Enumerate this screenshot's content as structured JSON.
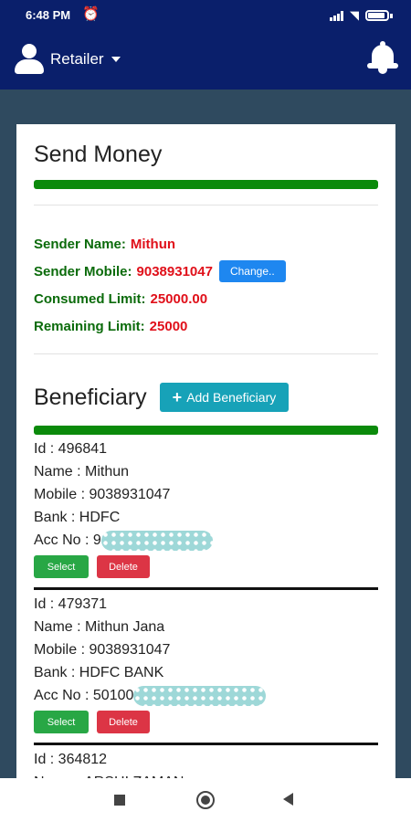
{
  "status_bar": {
    "time": "6:48 PM",
    "alarm_icon": "alarm-clock-icon"
  },
  "app_bar": {
    "role_label": "Retailer",
    "user_icon": "user-icon",
    "notification_icon": "bell-icon"
  },
  "send_money": {
    "title": "Send Money",
    "sender_name_label": "Sender Name:",
    "sender_name": "Mithun",
    "sender_mobile_label": "Sender Mobile:",
    "sender_mobile": "9038931047",
    "change_button": "Change..",
    "consumed_limit_label": "Consumed Limit:",
    "consumed_limit": "25000.00",
    "remaining_limit_label": "Remaining Limit:",
    "remaining_limit": "25000"
  },
  "beneficiary": {
    "title": "Beneficiary",
    "add_button": "Add Beneficiary",
    "select_label": "Select",
    "delete_label": "Delete",
    "items": [
      {
        "id": "Id : 496841",
        "name": "Name : Mithun",
        "mobile": "Mobile : 9038931047",
        "bank": "Bank : HDFC",
        "acc_no": "Acc No : 9"
      },
      {
        "id": "Id : 479371",
        "name": "Name : Mithun Jana",
        "mobile": "Mobile : 9038931047",
        "bank": "Bank : HDFC BANK",
        "acc_no": "Acc No : 50100"
      },
      {
        "id": "Id : 364812",
        "name": "Name : ARSHI ZAMAN"
      }
    ]
  },
  "colors": {
    "header": "#0a1f6b",
    "label_green": "#0b6b0b",
    "value_red": "#e0101a",
    "progress_green": "#0b8a0b",
    "change_blue": "#1e87f0",
    "add_teal": "#17a2b8",
    "select_green": "#28a745",
    "delete_red": "#dc3545",
    "background": "#2f4a5f"
  }
}
